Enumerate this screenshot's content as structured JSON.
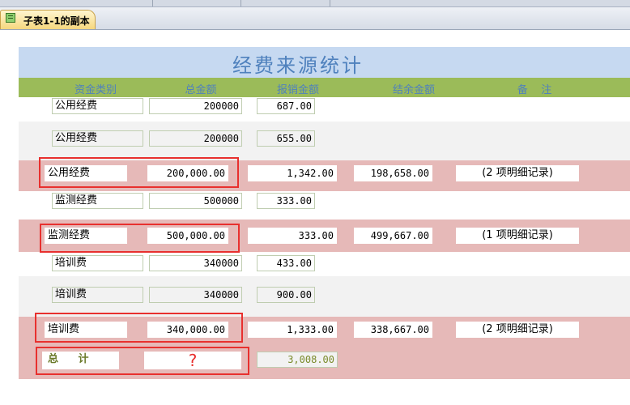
{
  "tab": {
    "label": "子表1-1的副本"
  },
  "report": {
    "title": "经费来源统计",
    "headers": [
      "资金类别",
      "总金额",
      "报销金额",
      "结余金额",
      "备    注"
    ]
  },
  "groups": [
    {
      "details": [
        {
          "category": "公用经费",
          "total": "200000",
          "reimbursed": "687.00"
        },
        {
          "category": "公用经费",
          "total": "200000",
          "reimbursed": "655.00"
        }
      ],
      "summary": {
        "category": "公用经费",
        "total": "200,000.00",
        "reimbursed": "1,342.00",
        "balance": "198,658.00",
        "note": "(2 项明细记录)"
      }
    },
    {
      "details": [
        {
          "category": "监测经费",
          "total": "500000",
          "reimbursed": "333.00"
        }
      ],
      "summary": {
        "category": "监测经费",
        "total": "500,000.00",
        "reimbursed": "333.00",
        "balance": "499,667.00",
        "note": "(1 项明细记录)"
      }
    },
    {
      "details": [
        {
          "category": "培训费",
          "total": "340000",
          "reimbursed": "433.00"
        },
        {
          "category": "培训费",
          "total": "340000",
          "reimbursed": "900.00"
        }
      ],
      "summary": {
        "category": "培训费",
        "total": "340,000.00",
        "reimbursed": "1,333.00",
        "balance": "338,667.00",
        "note": "(2 项明细记录)"
      }
    }
  ],
  "grand_total": {
    "label": "总 计",
    "total": "?",
    "reimbursed": "3,008.00"
  },
  "colors": {
    "title_band": "#c6d9f1",
    "title_text": "#4f81bd",
    "header_band": "#9bbb59",
    "summary_band": "#e6b9b8",
    "alt_band": "#f2f2f2",
    "annotation": "#e8302e"
  }
}
